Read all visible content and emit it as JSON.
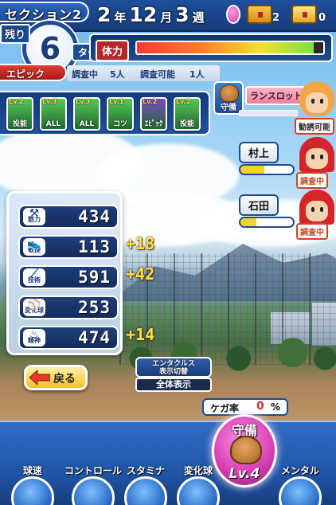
{
  "header": {
    "section_label": "セクション2",
    "date": {
      "year": "2",
      "year_unit": "年",
      "month": "12",
      "month_unit": "月",
      "week": "3",
      "week_unit": "週"
    },
    "chest_gold_count": "2",
    "chest_silver_count": "0"
  },
  "turns": {
    "remain_label": "残り",
    "value": "6",
    "unit": "ターン"
  },
  "stamina": {
    "label": "体力",
    "level": 0.95
  },
  "epic": {
    "label": "エピック",
    "research_label": "調査中",
    "research_count": "5人",
    "available_label": "調査可能",
    "available_count": "1人"
  },
  "cards": [
    {
      "level": "Lv.2",
      "name": "投能",
      "color": "#58c65a"
    },
    {
      "level": "Lv.3",
      "name": "ALL",
      "color": "#58c65a"
    },
    {
      "level": "Lv.3",
      "name": "ALL",
      "color": "#58c65a"
    },
    {
      "level": "Lv.1",
      "name": "コツ",
      "color": "#58c65a"
    },
    {
      "level": "Lv.2",
      "name": "ｴﾋﾟｯｸ",
      "color": "#7c4ac8"
    },
    {
      "level": "Lv.2",
      "name": "投能",
      "color": "#58c65a"
    }
  ],
  "random_slot": {
    "position_label": "守備",
    "label": "ランスロット",
    "call_label": "勧誘可能"
  },
  "teammates": [
    {
      "name": "村上",
      "status": "調査中",
      "fill": 0.45
    },
    {
      "name": "石田",
      "status": "調査中",
      "fill": 0.3
    }
  ],
  "stats": [
    {
      "icon": "muscle-icon",
      "label": "筋力",
      "value": "434",
      "plus": ""
    },
    {
      "icon": "shoe-icon",
      "label": "敏捷",
      "value": "113",
      "plus": "+18"
    },
    {
      "icon": "bat-icon",
      "label": "技術",
      "value": "591",
      "plus": "+42"
    },
    {
      "icon": "curveball-icon",
      "label": "変化球",
      "value": "253",
      "plus": ""
    },
    {
      "icon": "spirit-icon",
      "label": "精神",
      "value": "474",
      "plus": "+14"
    }
  ],
  "controls": {
    "back_label": "戻る",
    "view_switch_top": "エンタクルス\n表示切替",
    "view_switch_bottom": "全体表示"
  },
  "injury": {
    "label": "ケガ率",
    "value": "0",
    "unit": "%"
  },
  "defense": {
    "title": "守備",
    "level": "Lv.4"
  },
  "practice_menu": [
    {
      "label": "球速"
    },
    {
      "label": "コントロール"
    },
    {
      "label": "スタミナ"
    },
    {
      "label": "変化球"
    },
    {
      "label": "メンタル"
    }
  ],
  "colors": {
    "panel_blue": "#1b4a96",
    "epic_red": "#e33d2f",
    "bonus_yellow": "#ffe04a",
    "defense_pink": "#d43bb0"
  }
}
